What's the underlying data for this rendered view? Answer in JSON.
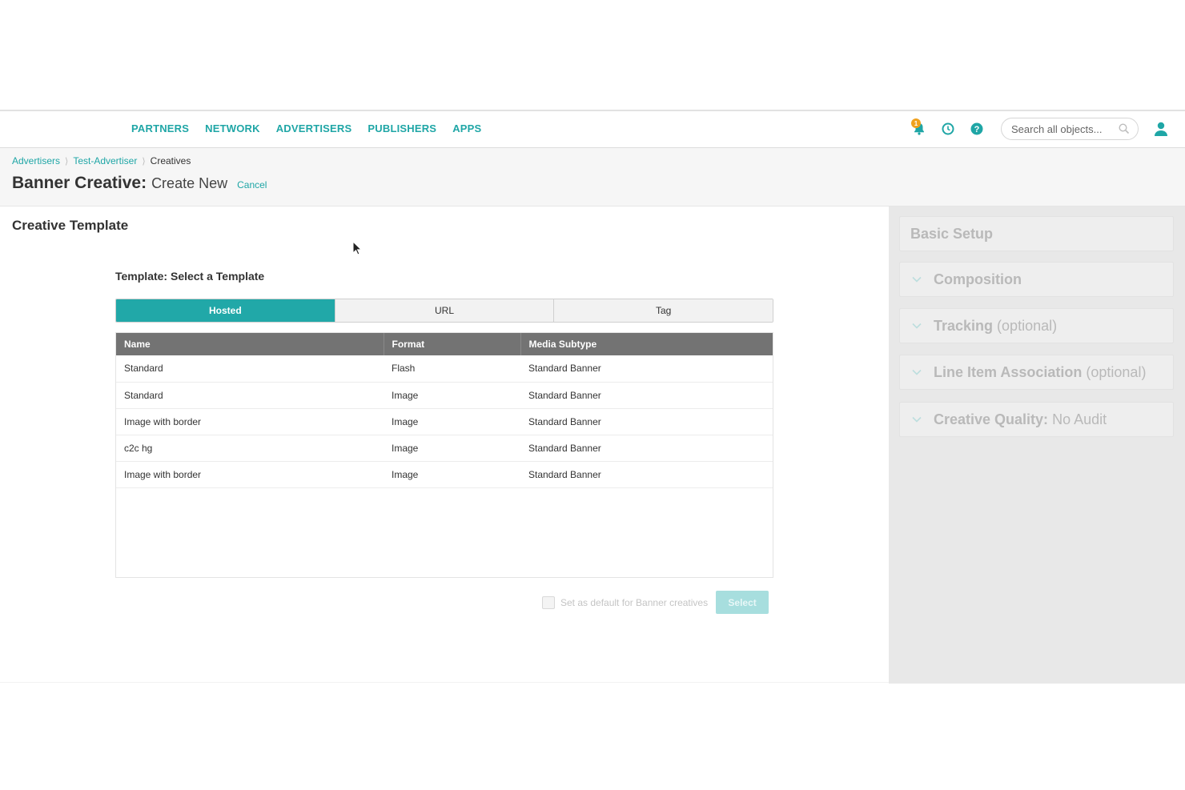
{
  "nav": {
    "links": [
      "PARTNERS",
      "NETWORK",
      "ADVERTISERS",
      "PUBLISHERS",
      "APPS"
    ],
    "notification_count": "1",
    "search_placeholder": "Search all objects..."
  },
  "breadcrumb": {
    "items": [
      "Advertisers",
      "Test-Advertiser"
    ],
    "current": "Creatives"
  },
  "page": {
    "title_main": "Banner Creative:",
    "title_sub": "Create New",
    "cancel_label": "Cancel"
  },
  "main": {
    "section_title": "Creative Template",
    "template_label": "Template: Select a Template",
    "tabs": [
      {
        "label": "Hosted",
        "active": true
      },
      {
        "label": "URL",
        "active": false
      },
      {
        "label": "Tag",
        "active": false
      }
    ],
    "table": {
      "columns": [
        "Name",
        "Format",
        "Media Subtype"
      ],
      "rows": [
        [
          "Standard",
          "Flash",
          "Standard Banner"
        ],
        [
          "Standard",
          "Image",
          "Standard Banner"
        ],
        [
          "Image with border",
          "Image",
          "Standard Banner"
        ],
        [
          "c2c hg",
          "Image",
          "Standard Banner"
        ],
        [
          "Image with border",
          "Image",
          "Standard Banner"
        ]
      ]
    },
    "default_checkbox_label": "Set as default for Banner creatives",
    "select_button_label": "Select"
  },
  "sidebar": {
    "items": [
      {
        "label": "Basic Setup",
        "optional": ""
      },
      {
        "label": "Composition",
        "optional": ""
      },
      {
        "label": "Tracking",
        "optional": "(optional)"
      },
      {
        "label": "Line Item Association",
        "optional": "(optional)"
      },
      {
        "label": "Creative Quality:",
        "optional": "No Audit"
      }
    ]
  },
  "colors": {
    "accent": "#21a8a8",
    "notification": "#f0a11e",
    "table_header": "#737373"
  }
}
